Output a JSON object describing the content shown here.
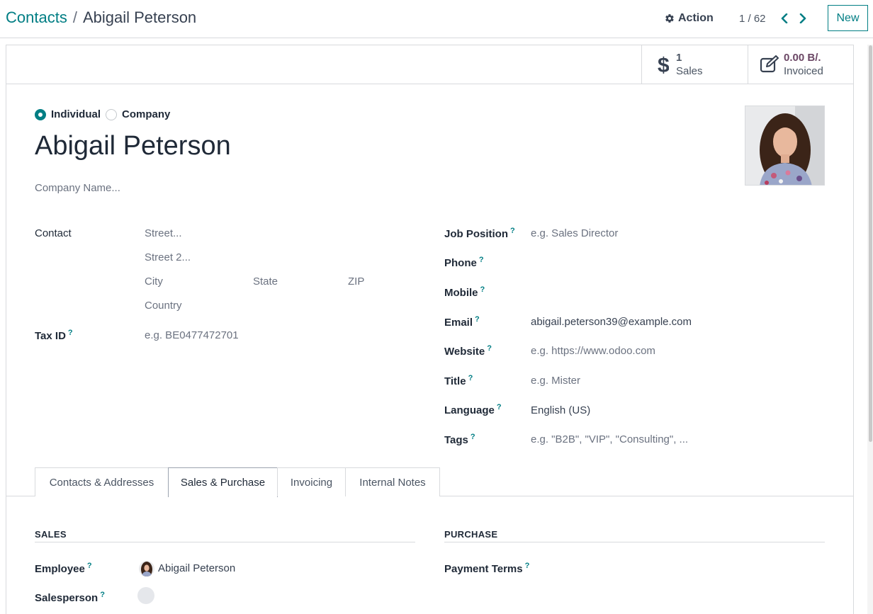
{
  "breadcrumb": {
    "parent": "Contacts",
    "separator": "/",
    "current": "Abigail Peterson"
  },
  "toolbar": {
    "action_label": "Action",
    "pager": "1 / 62",
    "new_label": "New"
  },
  "smart_buttons": {
    "sales": {
      "value": "1",
      "label": "Sales",
      "icon": "dollar-icon"
    },
    "invoiced": {
      "value": "0.00 B/.",
      "label": "Invoiced",
      "icon": "edit-invoice-icon"
    }
  },
  "company_type": {
    "individual": "Individual",
    "company": "Company",
    "selected": "Individual"
  },
  "partner": {
    "name": "Abigail Peterson",
    "company_placeholder": "Company Name..."
  },
  "address": {
    "label": "Contact",
    "street_placeholder": "Street...",
    "street2_placeholder": "Street 2...",
    "city_placeholder": "City",
    "state_placeholder": "State",
    "zip_placeholder": "ZIP",
    "country_placeholder": "Country"
  },
  "tax": {
    "label": "Tax ID",
    "placeholder": "e.g. BE0477472701"
  },
  "right_fields": {
    "job_position": {
      "label": "Job Position",
      "placeholder": "e.g. Sales Director"
    },
    "phone": {
      "label": "Phone",
      "value": ""
    },
    "mobile": {
      "label": "Mobile",
      "value": ""
    },
    "email": {
      "label": "Email",
      "value": "abigail.peterson39@example.com"
    },
    "website": {
      "label": "Website",
      "placeholder": "e.g. https://www.odoo.com"
    },
    "title": {
      "label": "Title",
      "placeholder": "e.g. Mister"
    },
    "language": {
      "label": "Language",
      "value": "English (US)"
    },
    "tags": {
      "label": "Tags",
      "placeholder": "e.g. \"B2B\", \"VIP\", \"Consulting\", ..."
    }
  },
  "tooltip_mark": "?",
  "tabs": [
    "Contacts & Addresses",
    "Sales & Purchase",
    "Invoicing",
    "Internal Notes"
  ],
  "active_tab": "Sales & Purchase",
  "sales_section": {
    "title": "SALES",
    "employee_label": "Employee",
    "employee_value": "Abigail Peterson",
    "salesperson_label": "Salesperson"
  },
  "purchase_section": {
    "title": "PURCHASE",
    "payment_terms_label": "Payment Terms"
  },
  "colors": {
    "accent": "#017e84",
    "invoiced": "#6b4765"
  }
}
